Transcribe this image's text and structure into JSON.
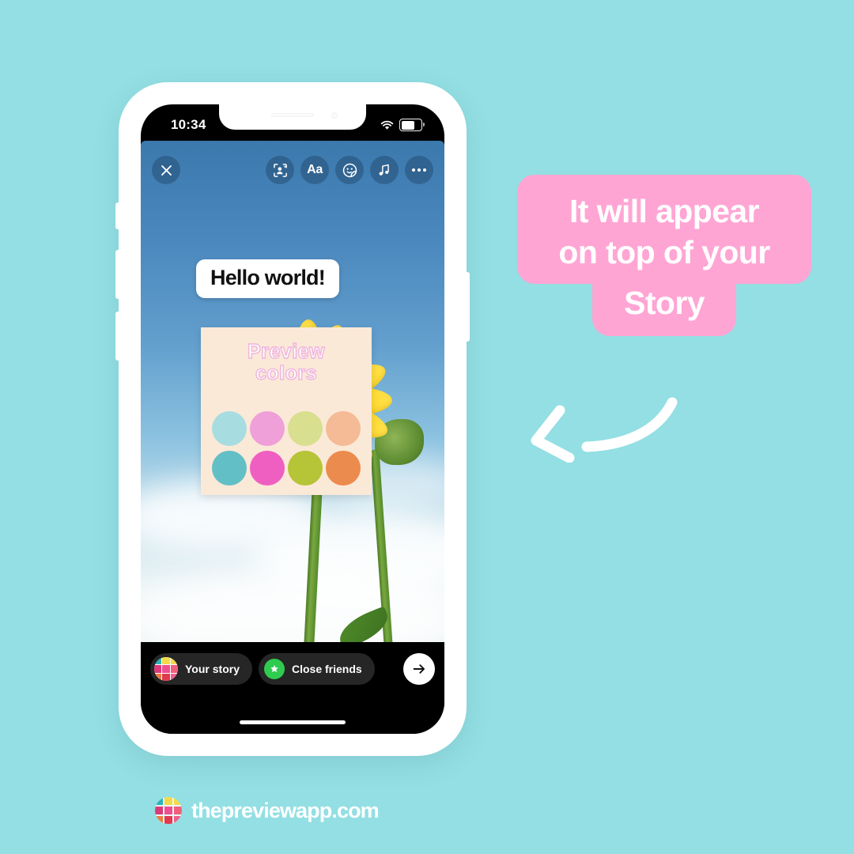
{
  "background_color": "#93dfe3",
  "phone": {
    "status_bar": {
      "time": "10:34",
      "wifi_icon": "wifi-icon",
      "battery_icon": "battery-icon",
      "battery_level_percent": 62
    },
    "story_editor": {
      "close_icon": "close-x-icon",
      "tools": [
        {
          "name": "effects-avatar-icon",
          "label": ""
        },
        {
          "name": "text-tool",
          "label": "Aa"
        },
        {
          "name": "sticker-icon",
          "label": ""
        },
        {
          "name": "music-icon",
          "label": ""
        },
        {
          "name": "more-options-icon",
          "label": ""
        }
      ],
      "caption": {
        "text": "Hello world!"
      },
      "sticker": {
        "title_line1": "Preview",
        "title_line2": "colors",
        "background_color": "#fbe9d8",
        "title_outline_color": "#f0b9dd",
        "swatches": [
          {
            "name": "swatch-light-teal",
            "color": "#a7dde0"
          },
          {
            "name": "swatch-light-pink",
            "color": "#efa0d8"
          },
          {
            "name": "swatch-light-olive",
            "color": "#d8df8e"
          },
          {
            "name": "swatch-light-peach",
            "color": "#f5bb96"
          },
          {
            "name": "swatch-teal",
            "color": "#63bfc6"
          },
          {
            "name": "swatch-magenta",
            "color": "#ef5fc1"
          },
          {
            "name": "swatch-olive",
            "color": "#b6c437"
          },
          {
            "name": "swatch-orange",
            "color": "#ec8b4e"
          }
        ]
      },
      "bottom_bar": {
        "your_story_label": "Your story",
        "close_friends_label": "Close friends",
        "close_friends_badge_color": "#2fcb4f",
        "send_icon": "arrow-right-icon"
      }
    }
  },
  "callout": {
    "line1": "It will appear",
    "line2": "on top of your",
    "line3": "Story",
    "background_color": "#ffa5d4",
    "text_color": "#ffffff"
  },
  "arrow": {
    "name": "curved-left-arrow",
    "color": "#ffffff"
  },
  "footer": {
    "brand_text": "thepreviewapp.com",
    "logo_colors": [
      "#2bb3b8",
      "#f3d94a",
      "#f3d94a",
      "#d93b7a",
      "#ef4f8f",
      "#f0607c",
      "#ef7b3f",
      "#e03a4e",
      "#ef5f8c"
    ]
  }
}
